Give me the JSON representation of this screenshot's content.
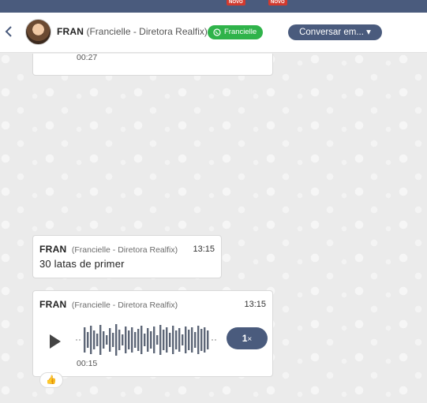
{
  "topbar": {
    "badges": [
      "NOVO",
      "NOVO"
    ]
  },
  "header": {
    "name": "FRAN",
    "role": "(Francielle - Diretora Realfix)",
    "channel_label": "Francielle",
    "converse_button": "Conversar em... ▾"
  },
  "messages": [
    {
      "duration": "00:27"
    },
    {
      "sender": "FRAN",
      "role": "(Francielle - Diretora Realfix)",
      "time": "13:15",
      "text": "30 latas de primer"
    },
    {
      "sender": "FRAN",
      "role": "(Francielle - Diretora Realfix)",
      "time": "13:15",
      "duration": "00:15",
      "speed_value": "1",
      "speed_unit": "×",
      "reaction": "👍"
    }
  ],
  "colors": {
    "accent": "#4a5b7d",
    "whatsapp": "#2fb34a",
    "badge_red": "#d23a2e"
  },
  "icons": {
    "back": "chevron-left-icon",
    "play": "play-icon",
    "whatsapp": "whatsapp-icon"
  }
}
